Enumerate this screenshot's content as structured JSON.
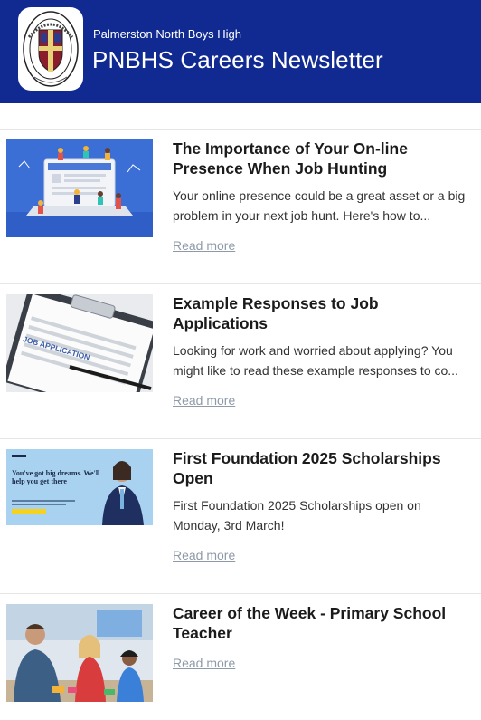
{
  "header": {
    "school_name": "Palmerston North Boys High",
    "newsletter_title": "PNBHS Careers Newsletter",
    "logo_text": "PNBHS"
  },
  "articles": [
    {
      "title": "The Importance of Your On-line Presence When Job Hunting",
      "excerpt": "Your online presence could be a great asset or a big problem in your next job hunt. Here's how to...",
      "read_more": "Read more",
      "thumb_icon": "laptop-people-illustration"
    },
    {
      "title": "Example Responses to Job Applications",
      "excerpt": "Looking for work and worried about applying? You might like to read these example responses to co...",
      "read_more": "Read more",
      "thumb_icon": "job-application-form-photo",
      "thumb_text": "JOB APPLICATION"
    },
    {
      "title": "First Foundation 2025 Scholarships Open",
      "excerpt": "First Foundation 2025 Scholarships open on\nMonday, 3rd March!",
      "read_more": "Read more",
      "thumb_icon": "scholarship-banner",
      "thumb_text": "You've got big dreams. We'll help you get there"
    },
    {
      "title": "Career of the Week - Primary School Teacher",
      "excerpt": "",
      "read_more": "Read more",
      "thumb_icon": "classroom-teacher-photo"
    }
  ],
  "colors": {
    "header_bg": "#112a91",
    "link": "#8e9aa8"
  }
}
